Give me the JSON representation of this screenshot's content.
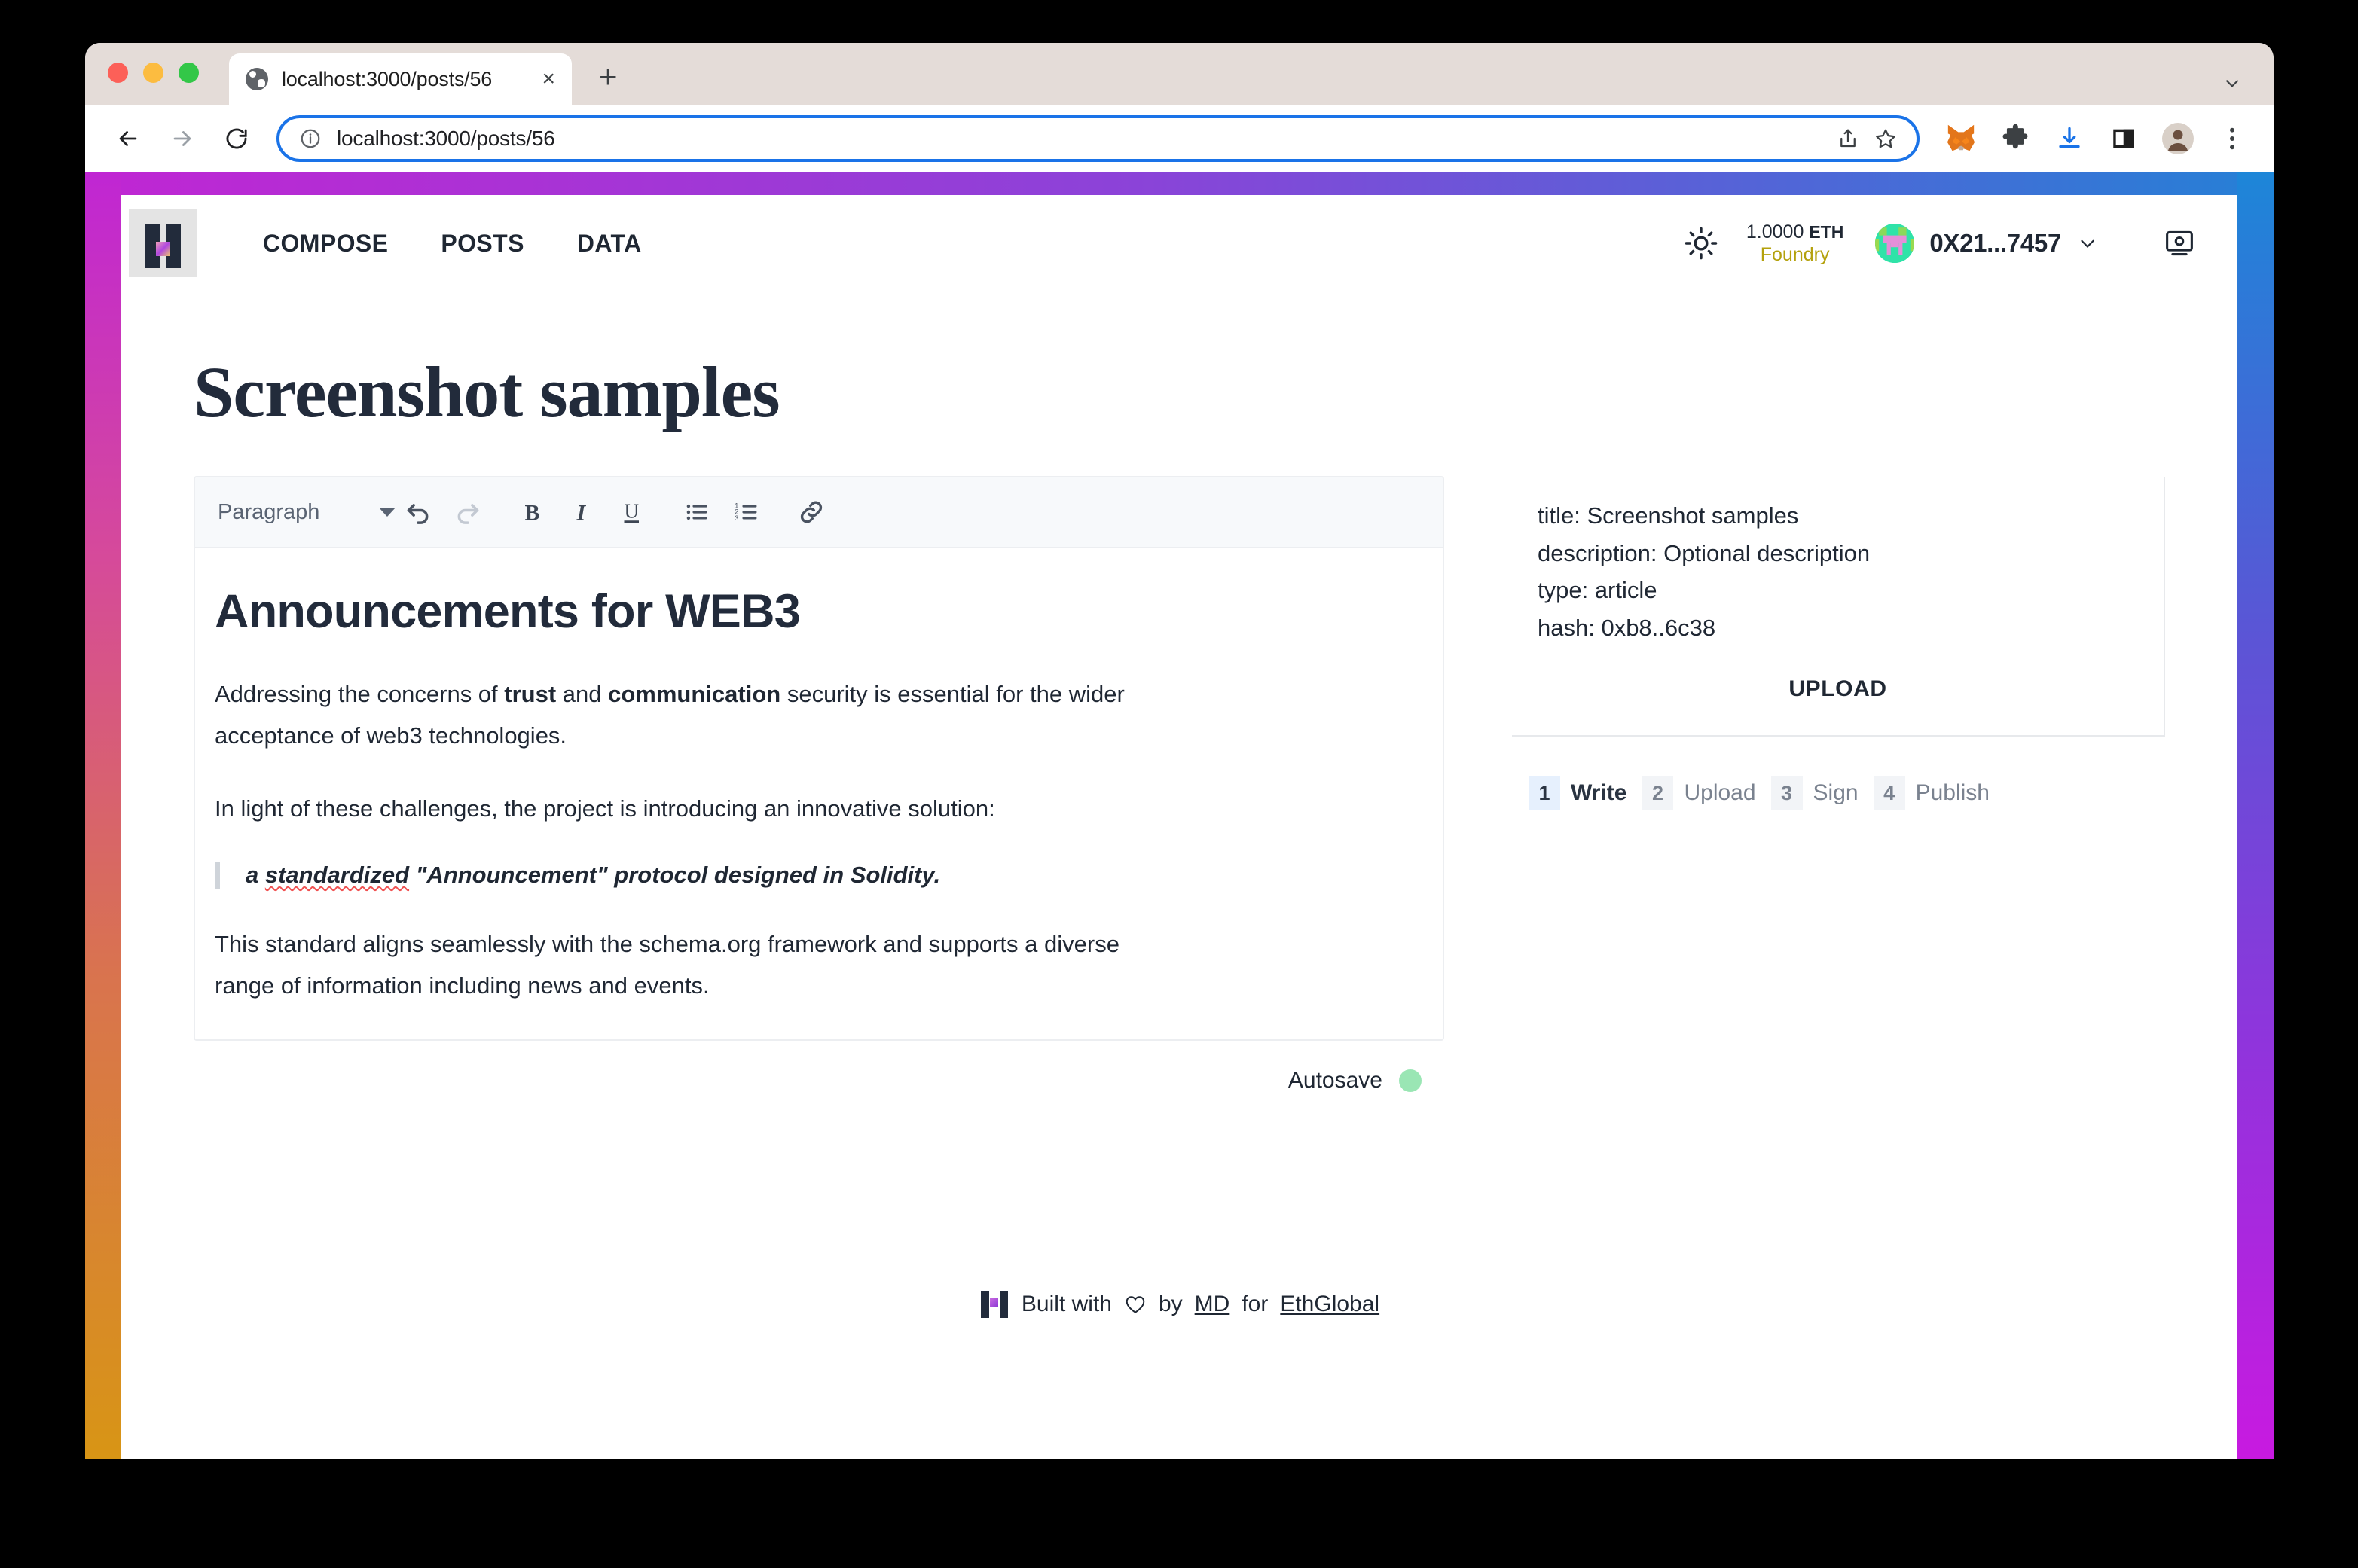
{
  "browser": {
    "tab": {
      "title": "localhost:3000/posts/56",
      "favicon": "globe-icon",
      "close": "×"
    },
    "new_tab": "+",
    "omnibox": {
      "url": "localhost:3000/posts/56",
      "info_icon": "info-circle-icon",
      "share_icon": "share-icon",
      "bookmark_icon": "star-icon"
    },
    "actions": [
      "metamask-fox-icon",
      "extensions-puzzle-icon",
      "downloads-icon",
      "side-panel-icon",
      "profile-avatar-icon",
      "chrome-menu-icon"
    ]
  },
  "app": {
    "logo": "hypercerts-logo",
    "nav": [
      {
        "label": "COMPOSE"
      },
      {
        "label": "POSTS"
      },
      {
        "label": "DATA"
      }
    ],
    "theme_toggle_icon": "sun-icon",
    "balance": {
      "amount": "1.0000",
      "unit": "ETH",
      "network": "Foundry"
    },
    "account": {
      "avatar": "blockie-avatar",
      "address": "0X21...7457",
      "chevron": "chevron-down-icon"
    },
    "monitor_icon": "screen-icon"
  },
  "page": {
    "title": "Screenshot samples"
  },
  "editor": {
    "toolbar": {
      "style_select": "Paragraph",
      "buttons": [
        {
          "name": "undo-icon",
          "title": "Undo"
        },
        {
          "name": "redo-icon",
          "title": "Redo"
        },
        {
          "name": "bold-icon",
          "title": "B"
        },
        {
          "name": "italic-icon",
          "title": "I"
        },
        {
          "name": "underline-icon",
          "title": "U"
        },
        {
          "name": "bullet-list-icon",
          "title": "Bulleted list"
        },
        {
          "name": "ordered-list-icon",
          "title": "Numbered list"
        },
        {
          "name": "link-icon",
          "title": "Link"
        }
      ]
    },
    "document": {
      "heading": "Announcements for WEB3",
      "paragraph1_part1": "Addressing the concerns of ",
      "paragraph1_bold1": "trust",
      "paragraph1_part2": " and ",
      "paragraph1_bold2": "communication",
      "paragraph1_part3": " security is essential for the wider acceptance of web3 technologies.",
      "paragraph2": "In light of these challenges, the project is introducing an innovative solution:",
      "quote_misspelled_pre": "a ",
      "quote_misspelled": "standardized",
      "quote_rest": " \"Announcement\" protocol designed in Solidity.",
      "paragraph3": "This standard aligns seamlessly with the schema.org framework and supports a diverse range of information including news and events."
    },
    "autosave": {
      "label": "Autosave",
      "status_color": "#9ae6b4"
    }
  },
  "side_panel": {
    "meta": [
      "title: Screenshot samples",
      "description: Optional description",
      "type: article",
      "hash: 0xb8..6c38"
    ],
    "upload_button": "UPLOAD",
    "steps": [
      {
        "num": "1",
        "label": "Write",
        "active": true
      },
      {
        "num": "2",
        "label": "Upload",
        "active": false
      },
      {
        "num": "3",
        "label": "Sign",
        "active": false
      },
      {
        "num": "4",
        "label": "Publish",
        "active": false
      }
    ]
  },
  "footer": {
    "built_with": "Built with",
    "heart": "heart-icon",
    "by": "by",
    "author": "MD",
    "for": "for",
    "organization": "EthGlobal"
  },
  "colors": {
    "frame_gradient_start": "#c026d3",
    "frame_gradient_mid": "#d9734f",
    "frame_gradient_end": "#d89515",
    "frame_gradient_right_top": "#1d86d8",
    "accent_network": "#b4a10c",
    "autosave_green": "#9ae6b4",
    "step_active_bg": "#e6f0fd",
    "omnibox_focus": "#1a73e8"
  }
}
